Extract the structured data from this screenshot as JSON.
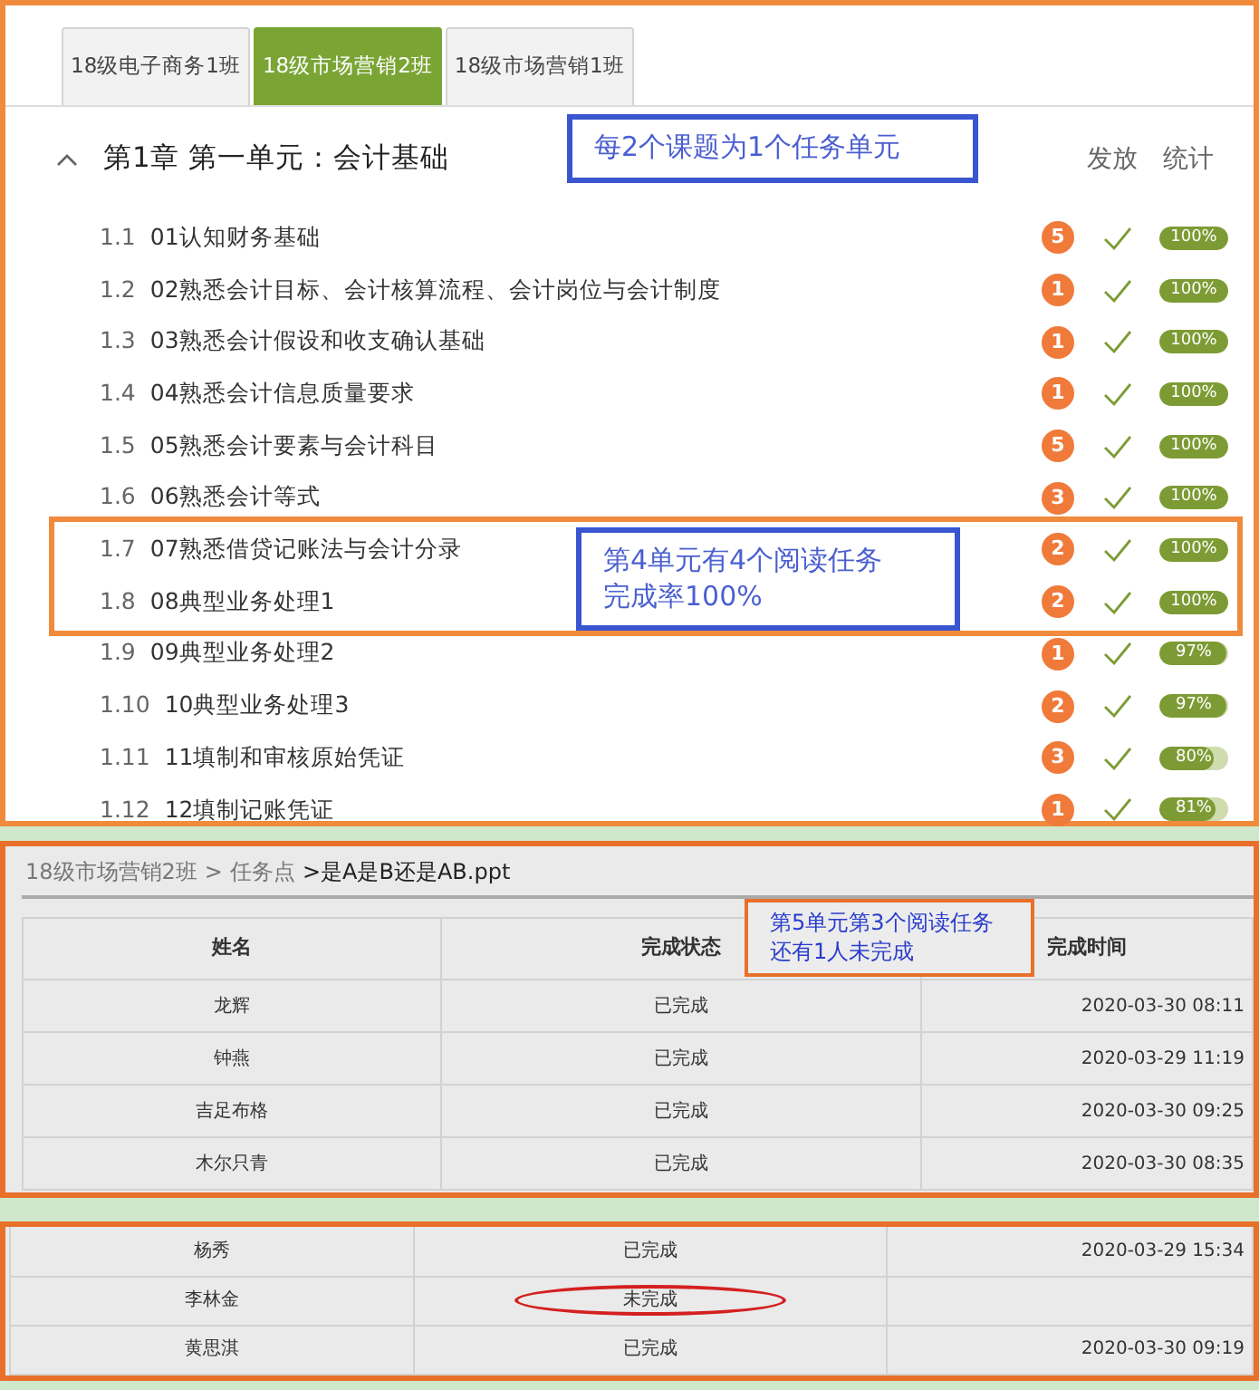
{
  "course_panel": {
    "tabs": [
      {
        "label": "18级电子商务1班",
        "selected": false
      },
      {
        "label": "18级市场营销2班",
        "selected": true
      },
      {
        "label": "18级市场营销1班",
        "selected": false
      }
    ],
    "chapter": {
      "title": "第1章 第一单元：会计基础",
      "expanded": true
    },
    "columns": [
      "发放",
      "统计"
    ],
    "lessons": [
      {
        "number": "1.1",
        "title": "01认知财务基础",
        "count": "5",
        "released": true,
        "percent": "100%",
        "level": 1,
        "highlighted": false
      },
      {
        "number": "1.2",
        "title": "02熟悉会计目标、会计核算流程、会计岗位与会计制度",
        "count": "1",
        "released": true,
        "percent": "100%",
        "level": 1,
        "highlighted": false
      },
      {
        "number": "1.3",
        "title": "03熟悉会计假设和收支确认基础",
        "count": "1",
        "released": true,
        "percent": "100%",
        "level": 1,
        "highlighted": false
      },
      {
        "number": "1.4",
        "title": "04熟悉会计信息质量要求",
        "count": "1",
        "released": true,
        "percent": "100%",
        "level": 1,
        "highlighted": false
      },
      {
        "number": "1.5",
        "title": "05熟悉会计要素与会计科目",
        "count": "5",
        "released": true,
        "percent": "100%",
        "level": 1,
        "highlighted": false
      },
      {
        "number": "1.6",
        "title": "06熟悉会计等式",
        "count": "3",
        "released": true,
        "percent": "100%",
        "level": 1,
        "highlighted": false
      },
      {
        "number": "1.7",
        "title": "07熟悉借贷记账法与会计分录",
        "count": "2",
        "released": true,
        "percent": "100%",
        "level": 1,
        "highlighted": true
      },
      {
        "number": "1.8",
        "title": "08典型业务处理1",
        "count": "2",
        "released": true,
        "percent": "100%",
        "level": 1,
        "highlighted": true
      },
      {
        "number": "1.9",
        "title": "09典型业务处理2",
        "count": "1",
        "released": true,
        "percent": "97%",
        "level": 0.97,
        "highlighted": false
      },
      {
        "number": "1.10",
        "title": "10典型业务处理3",
        "count": "2",
        "released": true,
        "percent": "97%",
        "level": 0.97,
        "highlighted": false
      },
      {
        "number": "1.11",
        "title": "11填制和审核原始凭证",
        "count": "3",
        "released": true,
        "percent": "80%",
        "level": 0.8,
        "highlighted": false
      },
      {
        "number": "1.12",
        "title": "12填制记账凭证",
        "count": "1",
        "released": true,
        "percent": "81%",
        "level": 0.81,
        "highlighted": false
      }
    ],
    "annotations": [
      {
        "kind": "blue",
        "lines": [
          "每2个课题为1个任务单元"
        ]
      },
      {
        "kind": "blue",
        "lines": [
          "第4单元有4个阅读任务",
          "完成率100%"
        ]
      }
    ]
  },
  "task_panel": {
    "breadcrumb": [
      "18级市场营销2班",
      ">",
      "任务点",
      ">是A是B还是AB.ppt"
    ],
    "columns": [
      "姓名",
      "完成状态",
      "完成时间"
    ],
    "rows": [
      {
        "name": "龙辉",
        "status": "已完成",
        "time": "2020-03-30 08:11"
      },
      {
        "name": "钟燕",
        "status": "已完成",
        "time": "2020-03-29 11:19"
      },
      {
        "name": "吉足布格",
        "status": "已完成",
        "time": "2020-03-30 09:25"
      },
      {
        "name": "木尔只青",
        "status": "已完成",
        "time": "2020-03-30 08:35"
      }
    ],
    "annotations": [
      {
        "kind": "orange",
        "lines": [
          "第5单元第3个阅读任务",
          "还有1人未完成"
        ]
      }
    ]
  },
  "more_rows_panel": {
    "rows": [
      {
        "name": "杨秀",
        "status": "已完成",
        "time": "2020-03-29 15:34",
        "circled": false
      },
      {
        "name": "李林金",
        "status": "未完成",
        "circled": true
      },
      {
        "name": "黄思淇",
        "status": "已完成",
        "time": "2020-03-30 09:19",
        "circled": false
      }
    ]
  }
}
